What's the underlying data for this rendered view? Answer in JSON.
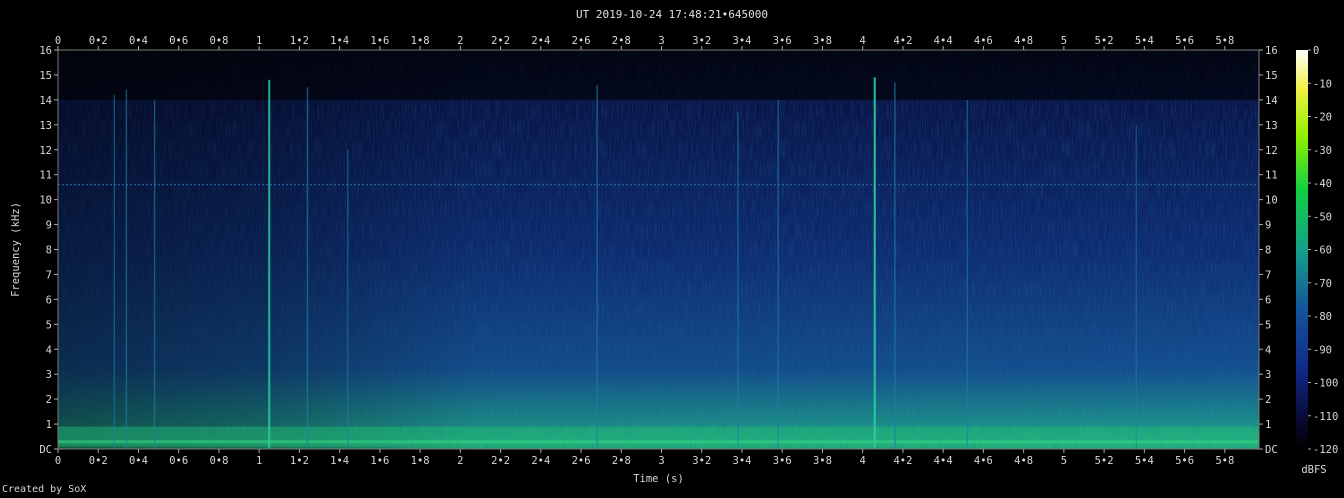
{
  "title": "UT 2019-10-24 17:48:21•645000",
  "credit": "Created by SoX",
  "chart_data": {
    "type": "heatmap",
    "title": "UT 2019-10-24 17:48:21•645000",
    "xlabel": "Time (s)",
    "ylabel": "Frequency (kHz)",
    "xlim": [
      0,
      5.97
    ],
    "ylim": [
      0,
      16
    ],
    "x_ticks": [
      "0",
      "0•2",
      "0•4",
      "0•6",
      "0•8",
      "1",
      "1•2",
      "1•4",
      "1•6",
      "1•8",
      "2",
      "2•2",
      "2•4",
      "2•6",
      "2•8",
      "3",
      "3•2",
      "3•4",
      "3•6",
      "3•8",
      "4",
      "4•2",
      "4•4",
      "4•6",
      "4•8",
      "5",
      "5•2",
      "5•4",
      "5•6",
      "5•8"
    ],
    "y_ticks": [
      "DC",
      "1",
      "2",
      "3",
      "4",
      "5",
      "6",
      "7",
      "8",
      "9",
      "10",
      "11",
      "12",
      "13",
      "14",
      "15",
      "16"
    ],
    "colorbar": {
      "label": "dBFS",
      "ticks": [
        "0",
        "-10",
        "-20",
        "-30",
        "-40",
        "-50",
        "-60",
        "-70",
        "-80",
        "-90",
        "-100",
        "-110",
        "-120"
      ],
      "range": [
        -120,
        0
      ]
    },
    "colors": {
      "background": "#000000",
      "low": "#03061a",
      "mid": "#0c2a6e",
      "high": "#1ac878",
      "top": "#ffffff"
    },
    "transients": [
      {
        "t": 0.28,
        "top_khz": 14.2,
        "level": 0.35
      },
      {
        "t": 0.34,
        "top_khz": 14.4,
        "level": 0.5
      },
      {
        "t": 0.48,
        "top_khz": 14.0,
        "level": 0.45
      },
      {
        "t": 1.05,
        "top_khz": 14.8,
        "level": 0.7
      },
      {
        "t": 1.24,
        "top_khz": 14.5,
        "level": 0.55
      },
      {
        "t": 1.44,
        "top_khz": 12.0,
        "level": 0.3
      },
      {
        "t": 2.68,
        "top_khz": 14.6,
        "level": 0.5
      },
      {
        "t": 3.38,
        "top_khz": 13.5,
        "level": 0.4
      },
      {
        "t": 3.58,
        "top_khz": 14.0,
        "level": 0.45
      },
      {
        "t": 4.06,
        "top_khz": 14.9,
        "level": 0.85
      },
      {
        "t": 4.16,
        "top_khz": 14.7,
        "level": 0.55
      },
      {
        "t": 4.52,
        "top_khz": 14.0,
        "level": 0.35
      },
      {
        "t": 5.36,
        "top_khz": 13.0,
        "level": 0.25
      }
    ],
    "hum_band_khz": 10.6,
    "low_band_khz": [
      0.1,
      0.9
    ]
  }
}
